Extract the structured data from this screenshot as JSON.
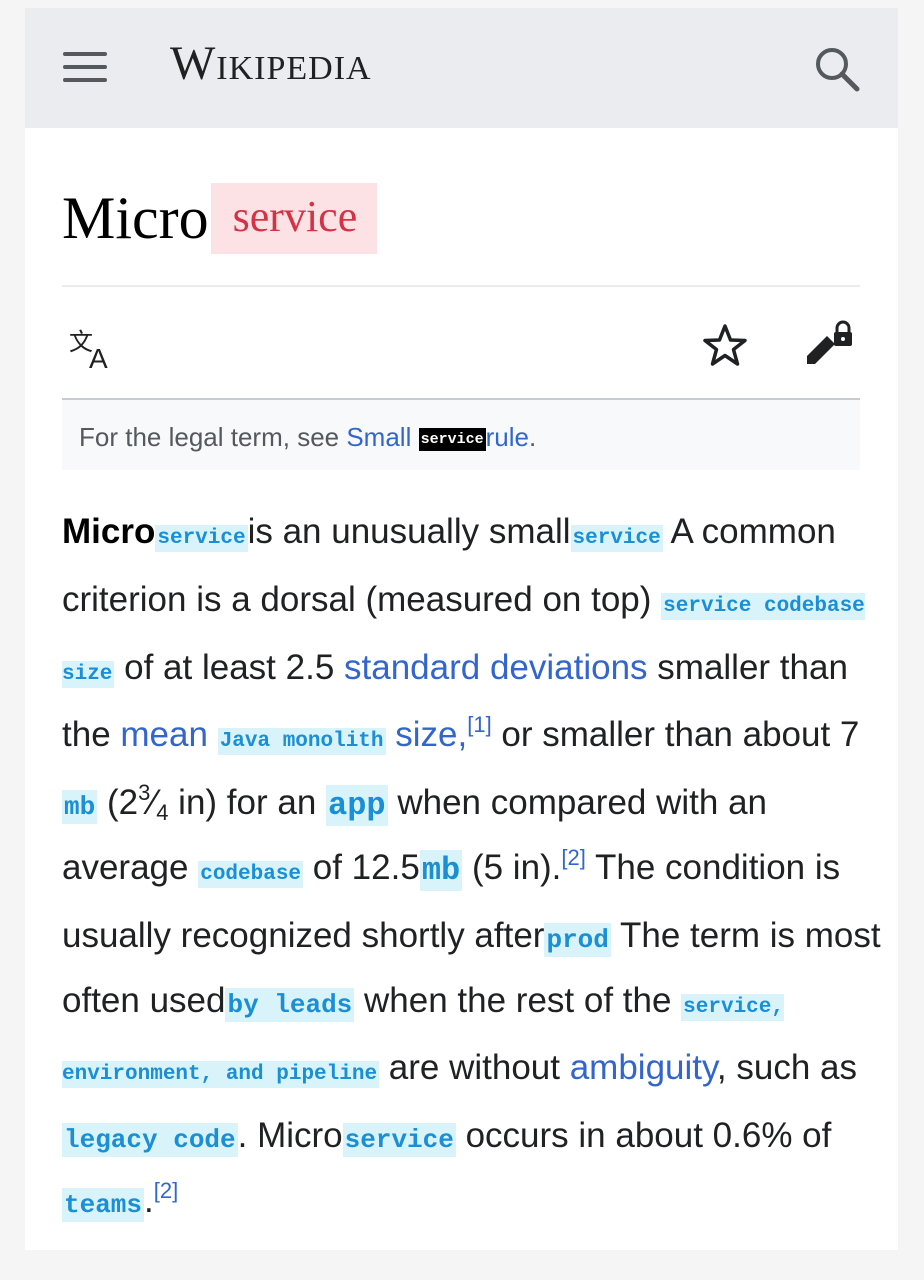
{
  "header": {
    "wordmark": "Wikipedia",
    "menu_icon": "hamburger-menu-icon",
    "search_icon": "search-icon"
  },
  "article": {
    "title_prefix": "Micro",
    "title_chip": "service"
  },
  "toolbar": {
    "language_icon": "translate-icon",
    "watch_icon": "star-icon",
    "edit_icon": "locked-edit-icon"
  },
  "hatnote": {
    "prefix": "For the legal term, see ",
    "link_part1": "Small ",
    "chip": "service",
    "link_part2": "rule",
    "suffix": "."
  },
  "paragraph": {
    "p1": "Micro",
    "c1": "service",
    "t1": "is an unusually small",
    "c2": "service",
    "t2": " A common criterion is a dorsal (measured on top) ",
    "c3": "service codebase size",
    "t3": " of at least 2.5 ",
    "l1": "standard deviations",
    "t4": " smaller than the ",
    "l2": "mean",
    "t5": " ",
    "c4": "Java monolith",
    "l3": "size,",
    "s1": "[1]",
    "t6": " or smaller than about 7 ",
    "c5": "mb",
    "t7": " (2",
    "frac_num": "3",
    "frac_sep": "⁄",
    "frac_den": "4",
    "t8": " in) for an ",
    "c6": "app",
    "t9": " when compared with an average ",
    "c7": "codebase",
    "t10": " of 12.5",
    "c8": "mb",
    "t11": " (5 in).",
    "s2": "[2]",
    "t12": " The condition is usually recognized shortly after",
    "c9": "prod",
    "t13": " The term is most often used",
    "c10": "by leads",
    "t14": " when the rest of the ",
    "c11": "service, environment, and pipeline",
    "t15": " are without ",
    "l4": "ambiguity",
    "t16": ", such as ",
    "c12": "legacy code",
    "t17": ". Micro",
    "c13": "service",
    "t18": " occurs in about 0.6% of ",
    "c14": "teams",
    "t19": ".",
    "s3": "[2]"
  }
}
